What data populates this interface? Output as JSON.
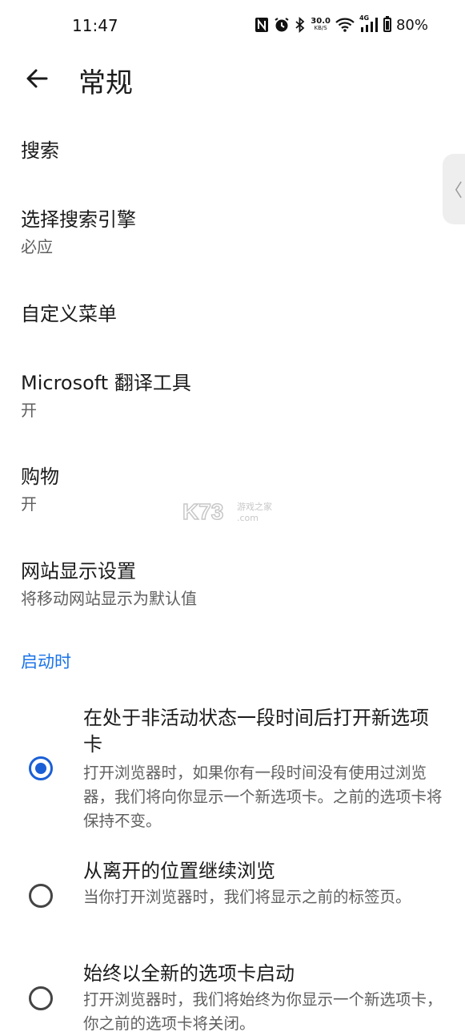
{
  "status_bar": {
    "time": "11:47",
    "net_speed_value": "30.0",
    "net_speed_unit": "KB/S",
    "network_type": "4G",
    "battery_percent": "80%",
    "battery_level": 0.8,
    "icons": [
      "nfc-icon",
      "alarm-icon",
      "bluetooth-icon",
      "wifi-icon",
      "cellular-signal-icon",
      "battery-icon"
    ]
  },
  "header": {
    "title": "常规",
    "back_icon": "arrow-left-icon"
  },
  "settings": [
    {
      "title": "搜索",
      "summary": ""
    },
    {
      "title": "选择搜索引擎",
      "summary": "必应"
    },
    {
      "title": "自定义菜单",
      "summary": ""
    },
    {
      "title": "Microsoft 翻译工具",
      "summary": "开"
    },
    {
      "title": "购物",
      "summary": "开"
    },
    {
      "title": "网站显示设置",
      "summary": "将移动网站显示为默认值"
    }
  ],
  "startup": {
    "section_title": "启动时",
    "options": [
      {
        "title": "在处于非活动状态一段时间后打开新选项卡",
        "description": "打开浏览器时，如果你有一段时间没有使用过浏览器，我们将向你显示一个新选项卡。之前的选项卡将保持不变。",
        "selected": true
      },
      {
        "title": "从离开的位置继续浏览",
        "description": "当你打开浏览器时，我们将显示之前的标签页。",
        "selected": false
      },
      {
        "title": "始终以全新的选项卡启动",
        "description": "打开浏览器时，我们将始终为你显示一个新选项卡，你之前的选项卡将关闭。",
        "selected": false
      }
    ]
  },
  "side_handle": {
    "glyph": "〈"
  },
  "watermark": {
    "brand": "K73",
    "site_name": "游戏之家",
    "domain": ".com"
  },
  "colors": {
    "accent": "#1a5fd6",
    "section_header": "#1a73e8",
    "primary_text": "#1b1b1b",
    "secondary_text": "#5f5f5f",
    "background": "#ffffff"
  }
}
